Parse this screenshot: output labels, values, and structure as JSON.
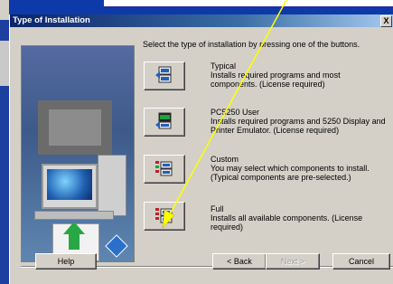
{
  "window": {
    "title": "Type of Installation",
    "close_label": "X"
  },
  "instruction": "Select the type of installation by pressing one of the buttons.",
  "options": [
    {
      "title": "Typical",
      "description": "Installs required programs and most components.  (License required)"
    },
    {
      "title": "PC5250 User",
      "description": "Installs required programs and 5250 Display and Printer Emulator.  (License required)"
    },
    {
      "title": "Custom",
      "description": "You may select which components to install. (Typical components are pre-selected.)"
    },
    {
      "title": "Full",
      "description": "Installs all available components.  (License required)"
    }
  ],
  "buttons": {
    "help": "Help",
    "back": "< Back",
    "next": "Next >",
    "cancel": "Cancel"
  },
  "colors": {
    "title_bar": "#0a246a",
    "dialog_face": "#d4d0c8",
    "annotation_arrow": "#ffff00"
  }
}
